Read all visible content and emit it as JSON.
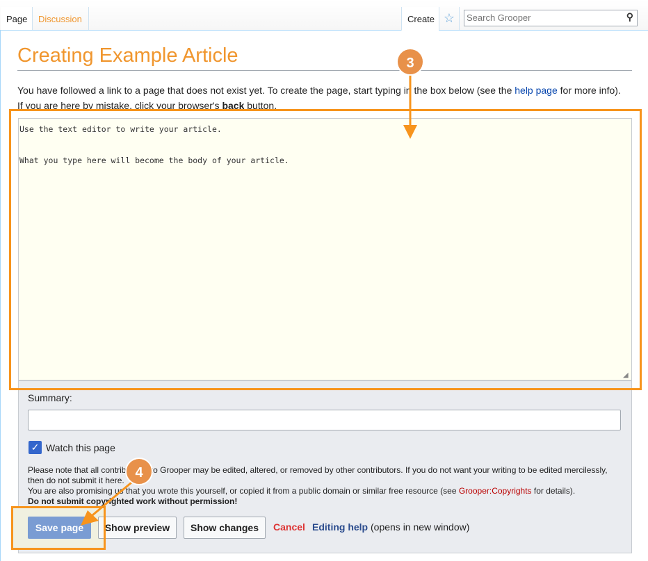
{
  "tabs": {
    "page": "Page",
    "discussion": "Discussion",
    "create": "Create"
  },
  "search": {
    "placeholder": "Search Grooper"
  },
  "title": "Creating Example Article",
  "intro": {
    "line1_pre": "You have followed a link to a page that does not exist yet. To create the page, start typing in the box below (see the ",
    "help_link": "help page",
    "line1_post": " for more info).",
    "line2_pre": "If you are here by mistake, click your browser's ",
    "back": "back",
    "line2_post": " button."
  },
  "editor": {
    "text": "Use the text editor to write your article.\n\nWhat you type here will become the body of your article."
  },
  "summary": {
    "label": "Summary:",
    "value": ""
  },
  "watch": {
    "label": "Watch this page",
    "checked": true
  },
  "notice": {
    "p1": "Please note that all contributions to Grooper may be edited, altered, or removed by other contributors. If you do not want your writing to be edited mercilessly, then do not submit it here.",
    "p2_pre": "You are also promising us that you wrote this yourself, or copied it from a public domain or similar free resource (see ",
    "p2_link": "Grooper:Copyrights",
    "p2_post": " for details).",
    "p3": "Do not submit copyrighted work without permission!"
  },
  "buttons": {
    "save": "Save page",
    "preview": "Show preview",
    "changes": "Show changes",
    "cancel": "Cancel",
    "help": "Editing help",
    "help_note": "(opens in new window)"
  },
  "callouts": {
    "step3": "3",
    "step4": "4"
  },
  "colors": {
    "accent": "#f7941d",
    "badge": "#e8914a",
    "title": "#f0962e"
  }
}
